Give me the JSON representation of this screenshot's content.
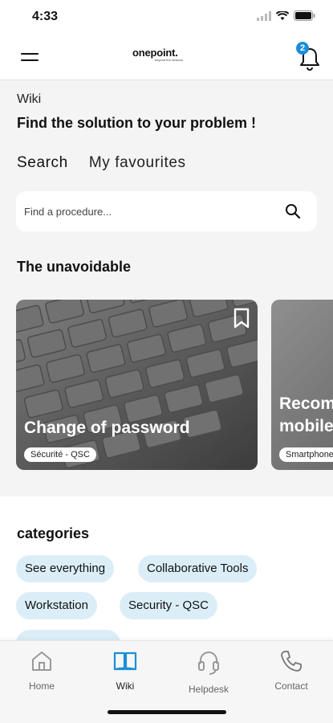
{
  "status_bar": {
    "time": "4:33"
  },
  "header": {
    "logo_text": "onepoint.",
    "logo_tagline": "beyond the obvious",
    "notification_count": "2"
  },
  "page": {
    "section_label": "Wiki",
    "title": "Find the solution to your problem !"
  },
  "tabs": [
    {
      "label": "Search"
    },
    {
      "label": "My favourites"
    }
  ],
  "search": {
    "placeholder": "Find a procedure..."
  },
  "unavoidable": {
    "title": "The unavoidable",
    "cards": [
      {
        "title": "Change of password",
        "tag": "Sécurité - QSC"
      },
      {
        "title": "Recom\nmobile",
        "tag": "Smartphone"
      }
    ]
  },
  "categories": {
    "title": "categories",
    "chips": [
      {
        "label": "See everything"
      },
      {
        "label": "Collaborative Tools"
      },
      {
        "label": "Workstation"
      },
      {
        "label": "Security - QSC"
      }
    ]
  },
  "bottom_nav": [
    {
      "label": "Home",
      "icon": "home-icon"
    },
    {
      "label": "Wiki",
      "icon": "book-icon"
    },
    {
      "label": "Helpdesk",
      "icon": "headset-icon"
    },
    {
      "label": "Contact",
      "icon": "phone-icon"
    }
  ],
  "colors": {
    "accent": "#1a8ed8",
    "chip_bg": "#dbeef8",
    "background": "#f4f4f4"
  }
}
